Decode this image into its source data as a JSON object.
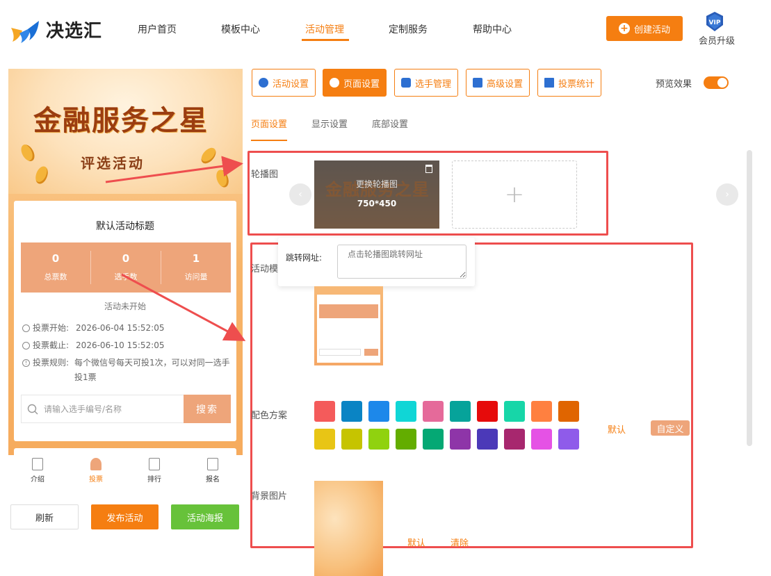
{
  "header": {
    "logo_text": "决选汇",
    "nav": [
      "用户首页",
      "模板中心",
      "活动管理",
      "定制服务",
      "帮助中心"
    ],
    "active_nav": "活动管理",
    "create_button": "创建活动",
    "vip_badge": "VIP",
    "vip_label": "会员升级"
  },
  "preview": {
    "banner_title": "金融服务之星",
    "banner_subtitle": "评选活动",
    "activity_title": "默认活动标题",
    "stats": [
      {
        "value": "0",
        "label": "总票数"
      },
      {
        "value": "0",
        "label": "选手数"
      },
      {
        "value": "1",
        "label": "访问量"
      }
    ],
    "status": "活动未开始",
    "vote_start_label": "投票开始:",
    "vote_start": "2026-06-04 15:52:05",
    "vote_end_label": "投票截止:",
    "vote_end": "2026-06-10 15:52:05",
    "vote_rule_label": "投票规则:",
    "vote_rule": "每个微信号每天可投1次，可以对同一选手投1票",
    "search_placeholder": "请输入选手编号/名称",
    "search_button": "搜索",
    "tabbar": [
      "介绍",
      "投票",
      "排行",
      "报名"
    ],
    "active_tab": "投票"
  },
  "bottom_buttons": {
    "refresh": "刷新",
    "publish": "发布活动",
    "poster": "活动海报"
  },
  "colors": {
    "accent": "#f57e11",
    "soft_accent": "#eea57a",
    "green": "#67c23a",
    "annotation_red": "#ee4e4e"
  },
  "toolbar": {
    "buttons": [
      "活动设置",
      "页面设置",
      "选手管理",
      "高级设置",
      "投票统计"
    ],
    "active": "页面设置",
    "preview_label": "预览效果",
    "preview_enabled": true
  },
  "subtabs": {
    "items": [
      "页面设置",
      "显示设置",
      "底部设置"
    ],
    "active": "页面设置"
  },
  "settings": {
    "carousel_label": "轮播图",
    "carousel_image_title": "金融服务之星",
    "carousel_replace": "更换轮播图",
    "carousel_size": "750*450",
    "jump_url_label": "跳转网址:",
    "jump_url_placeholder": "点击轮播图跳转网址",
    "template_label": "活动模",
    "color_scheme_label": "配色方案",
    "color_swatches": [
      "#f45b5b",
      "#0a84c4",
      "#1d88ea",
      "#10d6d6",
      "#e56a9a",
      "#06a39a",
      "#e60b0b",
      "#17d6a8",
      "#ff8040",
      "#e06500",
      "#e8c515",
      "#c6c400",
      "#90d20f",
      "#63ad00",
      "#05a874",
      "#8e35a8",
      "#4b39b8",
      "#a7276e",
      "#e552e5",
      "#8f5bea"
    ],
    "color_default": "默认",
    "color_custom": "自定义",
    "bg_image_label": "背景图片",
    "bg_default": "默认",
    "bg_clear": "清除"
  }
}
